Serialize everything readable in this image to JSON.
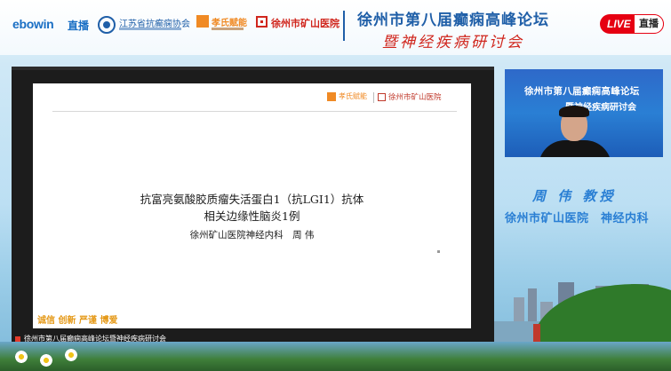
{
  "header": {
    "platform_logo": "ebowin",
    "platform_live": "直播",
    "association_name": "江苏省抗癫痫协会",
    "sponsor_name": "孝氏赋能",
    "hospital_name": "徐州市矿山医院",
    "forum_title": "徐州市第八届癫痫高峰论坛",
    "forum_subtitle": "暨神经疾病研讨会",
    "live_badge": "LIVE",
    "live_badge_zh": "直播"
  },
  "slide": {
    "logo_left": "孝氏赋能",
    "logo_right": "徐州市矿山医院",
    "title_line1": "抗富亮氨酸胶质瘤失活蛋白1（抗LGI1）抗体",
    "title_line2": "相关边缘性脑炎1例",
    "author": "徐州矿山医院神经内科　周 伟",
    "footer": "诚信 创新 严谨 博爱",
    "caption": "徐州市第八届癫痫高峰论坛暨神经疾病研讨会"
  },
  "speaker_video": {
    "bg_title_line1": "徐州市第八届癫痫高峰论坛",
    "bg_title_line2": "暨神经疾病研讨会"
  },
  "speaker": {
    "name": "周 伟 教授",
    "affiliation": "徐州市矿山医院　神经内科"
  },
  "colors": {
    "brand_blue": "#2a7fd4",
    "accent_red": "#d0261d",
    "live_red": "#e60012",
    "footer_orange": "#e59a1a"
  }
}
